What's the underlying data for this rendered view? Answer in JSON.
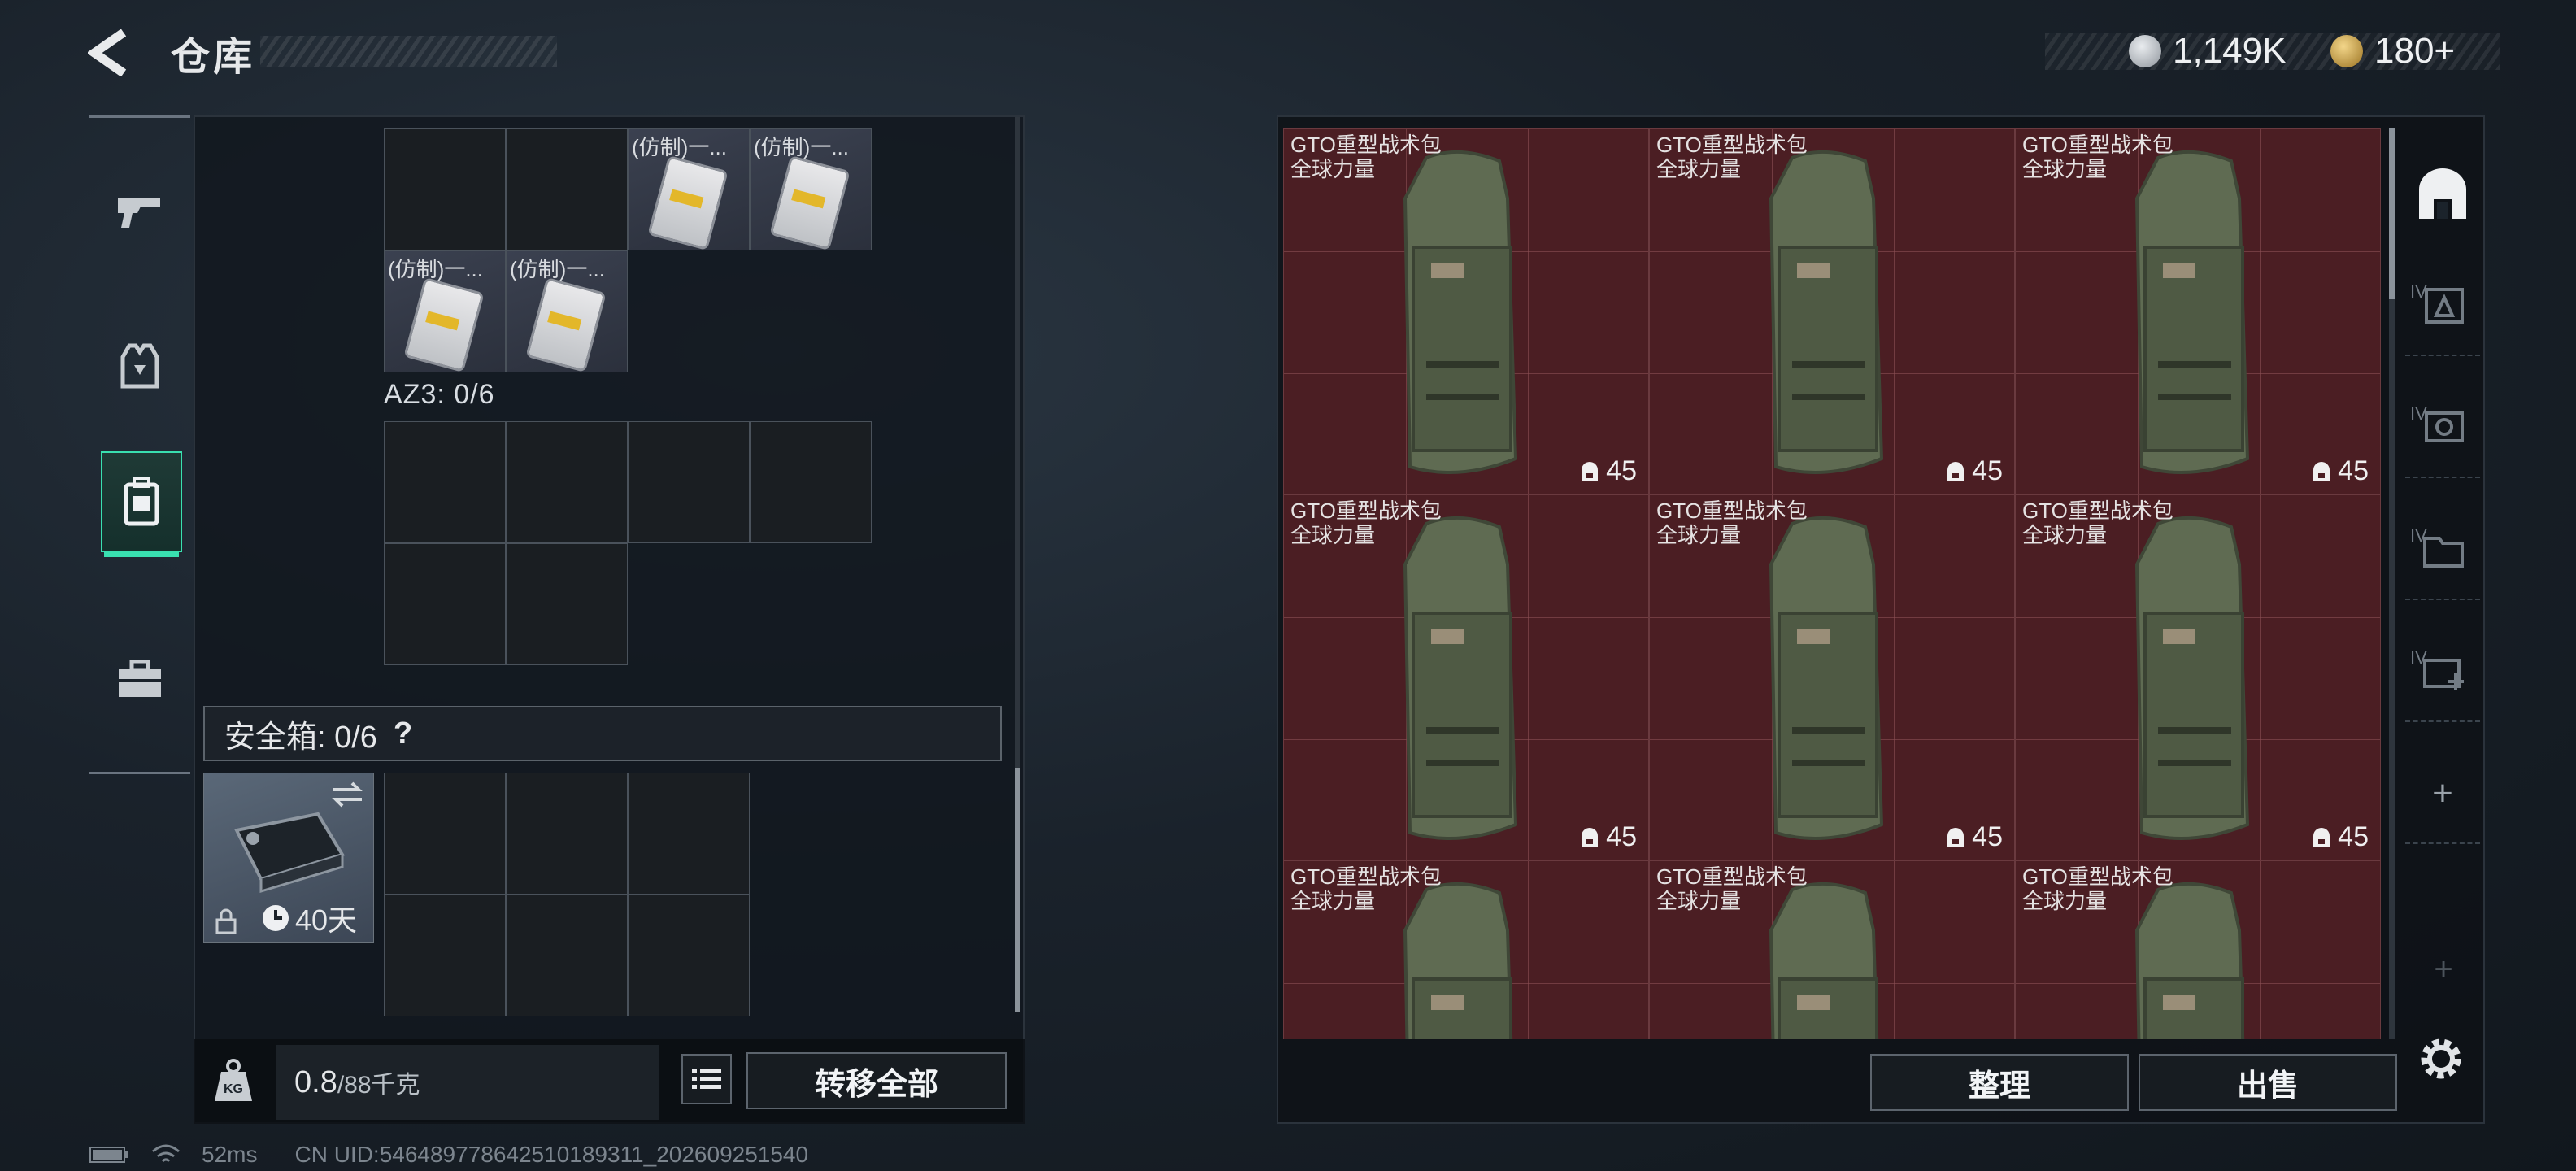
{
  "header": {
    "title": "仓库",
    "currency1": "1,149K",
    "currency2": "180+",
    "currency1_color": "#c9cdd2",
    "currency2_color": "#d9b35a"
  },
  "left_nav": {
    "items": [
      {
        "name": "weapon-tab",
        "icon": "gun-icon"
      },
      {
        "name": "armor-tab",
        "icon": "vest-icon"
      },
      {
        "name": "backpack-tab",
        "icon": "backpack-icon"
      },
      {
        "name": "supplies-tab",
        "icon": "toolbox-icon"
      }
    ],
    "active_index": 2,
    "accent": "#39e0b0"
  },
  "container": {
    "items": [
      {
        "label": "(仿制)一..."
      },
      {
        "label": "(仿制)一..."
      },
      {
        "label": "(仿制)一..."
      },
      {
        "label": "(仿制)一..."
      }
    ],
    "az3_label": "AZ3: 0/6",
    "safebox_label": "安全箱: 0/6",
    "safebox_help": "?",
    "safebox_days": "40天"
  },
  "footer_left": {
    "weight_current": "0.8",
    "weight_max": "/88千克",
    "transfer_all": "转移全部"
  },
  "stash": {
    "items": [
      {
        "name": "GTO重型战术包",
        "sub": "全球力量",
        "count": "45"
      },
      {
        "name": "GTO重型战术包",
        "sub": "全球力量",
        "count": "45"
      },
      {
        "name": "GTO重型战术包",
        "sub": "全球力量",
        "count": "45"
      },
      {
        "name": "GTO重型战术包",
        "sub": "全球力量",
        "count": "45"
      },
      {
        "name": "GTO重型战术包",
        "sub": "全球力量",
        "count": "45"
      },
      {
        "name": "GTO重型战术包",
        "sub": "全球力量",
        "count": "45"
      },
      {
        "name": "GTO重型战术包",
        "sub": "全球力量",
        "count": ""
      },
      {
        "name": "GTO重型战术包",
        "sub": "全球力量",
        "count": ""
      },
      {
        "name": "GTO重型战术包",
        "sub": "全球力量",
        "count": ""
      }
    ],
    "sort_label": "整理",
    "sell_label": "出售",
    "item_bg": "#4b1e23"
  },
  "right_nav": {
    "items": [
      "IV",
      "IV",
      "IV",
      "IV"
    ],
    "add": "+"
  },
  "status_bar": {
    "ping": "52ms",
    "uid": "CN UID:546489778642510189311_202609251540"
  }
}
